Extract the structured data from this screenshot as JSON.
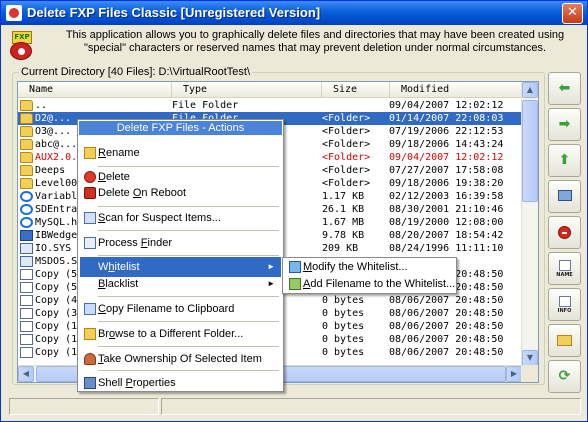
{
  "window": {
    "title": "Delete FXP Files Classic  [Unregistered Version]",
    "close_glyph": "✕"
  },
  "logo": {
    "text": "FXP"
  },
  "description": {
    "line1": "This application allows you to graphically delete files and directories that may have been created using",
    "line2": "\"special\" characters or reserved names that may prevent deletion under normal circumstances."
  },
  "directory": {
    "label": "Current Directory [40 Files]: D:\\VirtualRootTest\\"
  },
  "list": {
    "columns": [
      "Name",
      "Type",
      "Size",
      "Modified"
    ],
    "rows": [
      {
        "name": "..",
        "type": "File Folder",
        "size": "",
        "modified": "09/04/2007 12:02:12",
        "icon": "folder-icon",
        "state": "normal"
      },
      {
        "name": "D2@...",
        "type": "File Folder",
        "size": "<Folder>",
        "modified": "01/14/2007 22:08:03",
        "icon": "folder-icon",
        "state": "selected"
      },
      {
        "name": "O3@...",
        "type": "",
        "size": "<Folder>",
        "modified": "07/19/2006 22:12:53",
        "icon": "folder-icon",
        "state": "normal"
      },
      {
        "name": "abc@...",
        "type": "",
        "size": "<Folder>",
        "modified": "09/18/2006 14:43:24",
        "icon": "folder-icon",
        "state": "normal"
      },
      {
        "name": "AUX2.0...",
        "type": "",
        "size": "<Folder>",
        "modified": "09/04/2007 12:02:12",
        "icon": "folder-icon",
        "state": "red"
      },
      {
        "name": "Deeps",
        "type": "",
        "size": "<Folder>",
        "modified": "07/27/2007 17:58:08",
        "icon": "folder-icon",
        "state": "normal"
      },
      {
        "name": "Level00",
        "type": "",
        "size": "<Folder>",
        "modified": "09/18/2006 19:38:20",
        "icon": "folder-icon",
        "state": "normal"
      },
      {
        "name": "Variabl",
        "type": "",
        "size": "1.17 KB",
        "modified": "02/12/2003 16:39:58",
        "icon": "ie-icon",
        "state": "normal"
      },
      {
        "name": "SDEntra",
        "type": "",
        "size": "26.1 KB",
        "modified": "08/30/2001 21:10:46",
        "icon": "ie-icon",
        "state": "normal"
      },
      {
        "name": "MySQL.h",
        "type": "",
        "size": "1.67 MB",
        "modified": "08/19/2000 12:08:00",
        "icon": "ie-icon",
        "state": "normal"
      },
      {
        "name": "IBWedge",
        "type": "",
        "size": "9.78 KB",
        "modified": "08/20/2007 18:54:42",
        "icon": "exe-icon",
        "state": "normal"
      },
      {
        "name": "IO.SYS",
        "type": "",
        "size": "209 KB",
        "modified": "08/24/1996 11:11:10",
        "icon": "sys-icon",
        "state": "normal"
      },
      {
        "name": "MSDOS.S",
        "type": "",
        "size": "",
        "modified": "15:41:46",
        "icon": "sys-icon",
        "state": "normal"
      },
      {
        "name": "Copy (5",
        "type": "",
        "size": "0 bytes",
        "modified": "08/06/2007 20:48:50",
        "icon": "file-icon",
        "state": "normal"
      },
      {
        "name": "Copy (5",
        "type": "",
        "size": "0 bytes",
        "modified": "08/06/2007 20:48:50",
        "icon": "file-icon",
        "state": "normal"
      },
      {
        "name": "Copy (4",
        "type": "",
        "size": "0 bytes",
        "modified": "08/06/2007 20:48:50",
        "icon": "file-icon",
        "state": "normal"
      },
      {
        "name": "Copy (3",
        "type": "",
        "size": "0 bytes",
        "modified": "08/06/2007 20:48:50",
        "icon": "file-icon",
        "state": "normal"
      },
      {
        "name": "Copy (1",
        "type": "",
        "size": "0 bytes",
        "modified": "08/06/2007 20:48:50",
        "icon": "file-icon",
        "state": "normal"
      },
      {
        "name": "Copy (1",
        "type": "",
        "size": "0 bytes",
        "modified": "08/06/2007 20:48:50",
        "icon": "file-icon",
        "state": "normal"
      },
      {
        "name": "Copy (1",
        "type": "",
        "size": "0 bytes",
        "modified": "08/06/2007 20:48:50",
        "icon": "file-icon",
        "state": "normal"
      }
    ]
  },
  "context_menu": {
    "title": "Delete FXP Files - Actions",
    "items": {
      "rename": {
        "pre": "",
        "key": "R",
        "post": "ename",
        "icon": "rename-icon"
      },
      "delete": {
        "pre": "",
        "key": "D",
        "post": "elete",
        "icon": "delete-icon"
      },
      "delete_on_reboot": {
        "pre": "Delete ",
        "key": "O",
        "post": "n Reboot",
        "icon": "reboot-icon"
      },
      "scan": {
        "pre": "",
        "key": "S",
        "post": "can for Suspect Items...",
        "icon": "scan-icon"
      },
      "process_finder": {
        "pre": "Process ",
        "key": "F",
        "post": "inder",
        "icon": "process-finder-icon"
      },
      "whitelist": {
        "pre": "W",
        "key": "h",
        "post": "itelist",
        "icon": ""
      },
      "blacklist": {
        "pre": "",
        "key": "B",
        "post": "lacklist",
        "icon": ""
      },
      "copy_filename": {
        "pre": "",
        "key": "C",
        "post": "opy Filename to Clipboard",
        "icon": "clipboard-icon"
      },
      "browse": {
        "pre": "Br",
        "key": "o",
        "post": "wse to a Different Folder...",
        "icon": "browse-folder-icon"
      },
      "take_ownership": {
        "pre": "",
        "key": "T",
        "post": "ake Ownership Of Selected Item",
        "icon": "ownership-icon"
      },
      "shell_properties": {
        "pre": "Shell ",
        "key": "P",
        "post": "roperties",
        "icon": "shell-properties-icon"
      }
    },
    "arrow_glyph": "►"
  },
  "submenu": {
    "modify": {
      "pre": "",
      "key": "M",
      "post": "odify the Whitelist...",
      "icon": "whitelist-icon"
    },
    "add": {
      "pre": "",
      "key": "A",
      "post": "dd Filename to the Whitelist...",
      "icon": "add-whitelist-icon"
    }
  },
  "toolbar": {
    "back_glyph": "⬅",
    "forward_glyph": "➡",
    "up_glyph": "⬆",
    "name_label": "NAME",
    "info_label": "INFO",
    "refresh_glyph": "⟳",
    "scroll_up_glyph": "▲",
    "scroll_down_glyph": "▼",
    "scroll_left_glyph": "◀",
    "scroll_right_glyph": "▶"
  }
}
